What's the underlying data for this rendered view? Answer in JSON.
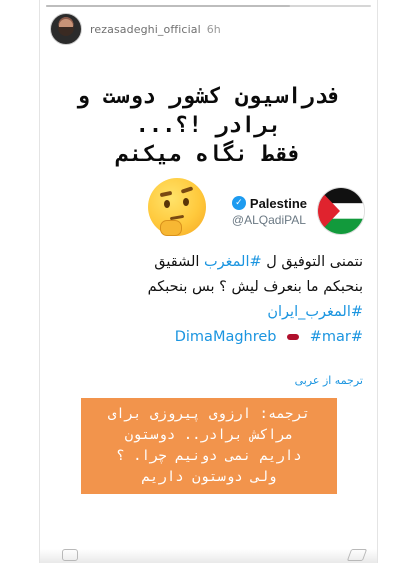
{
  "story": {
    "username": "rezasadeghi_official",
    "time": "6h",
    "progress": 0.75
  },
  "headline": {
    "line1": "فدراسیون کشور دوست و",
    "line2": "برادر !؟...",
    "line3": "فقط نگاه میکنم"
  },
  "emoji": "thinking-face",
  "tweet": {
    "name": "Palestine",
    "handle": "@ALQadiPAL",
    "line1_text": "نتمنى التوفيق ل ",
    "line1_hashtag": "#المغرب",
    "line1_tail": " الشقيق",
    "line2": "بنحبكم ما بنعرف ليش ؟ بس بنحبكم",
    "line3_hashtag": "#المغرب_ايران",
    "line4_tag1": "DimaMaghreb",
    "line4_tag2": "#mar#"
  },
  "translate_label": "ترجمه از عربی",
  "caption": {
    "line1": "ترجمه: ارزوی پیروزی برای",
    "line2": "مراکش برادر.. دوستون",
    "line3": "داریم نمی دونیم چرا. ؟",
    "line4": "ولی دوستون داریم"
  },
  "colors": {
    "accent": "#1b95e0",
    "caption_bg": "#f2944c",
    "verified": "#1d9bf0"
  }
}
